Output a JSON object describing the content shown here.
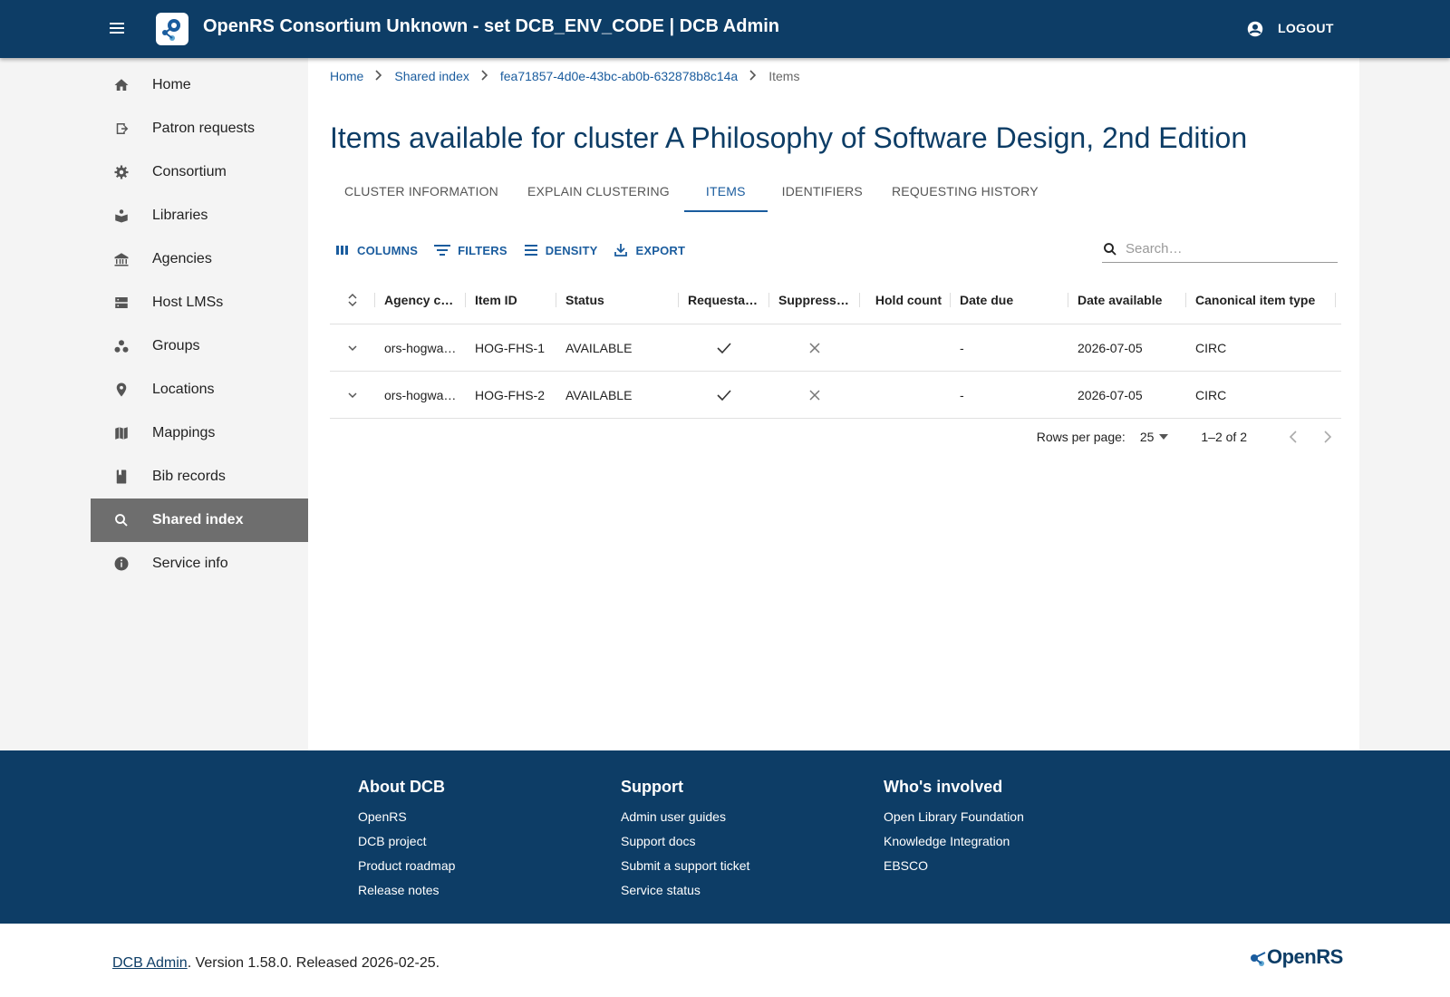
{
  "header": {
    "title": "OpenRS Consortium Unknown - set DCB_ENV_CODE | DCB Admin",
    "logout_label": "LOGOUT"
  },
  "sidebar": {
    "items": [
      {
        "label": "Home",
        "icon": "home-icon"
      },
      {
        "label": "Patron requests",
        "icon": "exit-to-app-icon"
      },
      {
        "label": "Consortium",
        "icon": "gear-icon"
      },
      {
        "label": "Libraries",
        "icon": "book-reader-icon"
      },
      {
        "label": "Agencies",
        "icon": "bank-icon"
      },
      {
        "label": "Host LMSs",
        "icon": "server-icon"
      },
      {
        "label": "Groups",
        "icon": "groups-icon"
      },
      {
        "label": "Locations",
        "icon": "location-pin-icon"
      },
      {
        "label": "Mappings",
        "icon": "map-icon"
      },
      {
        "label": "Bib records",
        "icon": "bookmark-book-icon"
      },
      {
        "label": "Shared index",
        "icon": "search-icon",
        "active": true
      },
      {
        "label": "Service info",
        "icon": "info-icon"
      }
    ]
  },
  "breadcrumb": {
    "home": "Home",
    "shared_index": "Shared index",
    "cluster_id": "fea71857-4d0e-43bc-ab0b-632878b8c14a",
    "current": "Items"
  },
  "page": {
    "title": "Items available for cluster A Philosophy of Software Design, 2nd Edition"
  },
  "tabs": [
    {
      "label": "CLUSTER INFORMATION"
    },
    {
      "label": "EXPLAIN CLUSTERING"
    },
    {
      "label": "ITEMS",
      "active": true
    },
    {
      "label": "IDENTIFIERS"
    },
    {
      "label": "REQUESTING HISTORY"
    }
  ],
  "toolbar": {
    "columns_label": "COLUMNS",
    "filters_label": "FILTERS",
    "density_label": "DENSITY",
    "export_label": "EXPORT",
    "search_placeholder": "Search…"
  },
  "table": {
    "columns": [
      "Agency code",
      "Item ID",
      "Status",
      "Requestable",
      "Suppressed",
      "Hold count",
      "Date due",
      "Date available",
      "Canonical item type"
    ],
    "rows": [
      {
        "agency_code": "ors-hogwarts",
        "item_id": "HOG-FHS-1",
        "status": "AVAILABLE",
        "requestable": true,
        "suppressed": false,
        "hold_count": "",
        "date_due": "-",
        "date_available": "2026-07-05",
        "canonical_item_type": "CIRC"
      },
      {
        "agency_code": "ors-hogwarts",
        "item_id": "HOG-FHS-2",
        "status": "AVAILABLE",
        "requestable": true,
        "suppressed": false,
        "hold_count": "",
        "date_due": "-",
        "date_available": "2026-07-05",
        "canonical_item_type": "CIRC"
      }
    ]
  },
  "pagination": {
    "rows_per_page_label": "Rows per page:",
    "rows_per_page": "25",
    "range": "1–2 of 2"
  },
  "footer": {
    "about": {
      "heading": "About DCB",
      "links": [
        "OpenRS",
        "DCB project",
        "Product roadmap",
        "Release notes"
      ]
    },
    "support": {
      "heading": "Support",
      "links": [
        "Admin user guides",
        "Support docs",
        "Submit a support ticket",
        "Service status"
      ]
    },
    "involved": {
      "heading": "Who's involved",
      "links": [
        "Open Library Foundation",
        "Knowledge Integration",
        "EBSCO"
      ]
    }
  },
  "bottom": {
    "app_link": "DCB Admin",
    "version_text": ". Version 1.58.0. Released 2026-02-25.",
    "logo_text": "OpenRS"
  },
  "colors": {
    "brand": "#0d3d66",
    "link": "#1a5c9e",
    "active_nav": "#6e6e6e"
  }
}
